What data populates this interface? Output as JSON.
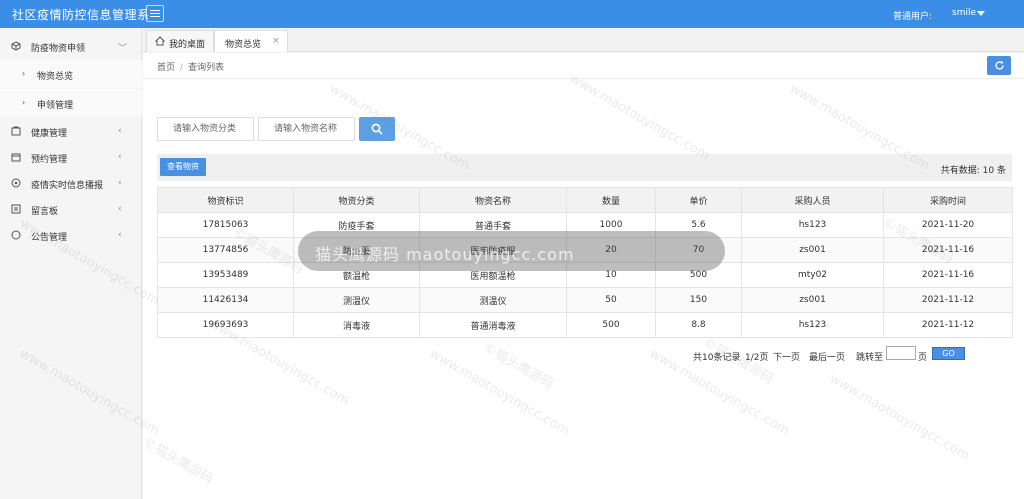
{
  "header": {
    "app_title": "社区疫情防控信息管理系",
    "user_role": "普通用户:",
    "user_name": "smile"
  },
  "sidebar": {
    "items": [
      {
        "label": "防疫物资申领",
        "icon": "cube-icon",
        "expanded": true,
        "children": [
          {
            "label": "物资总览"
          },
          {
            "label": "申领管理"
          }
        ]
      },
      {
        "label": "健康管理",
        "icon": "health-icon"
      },
      {
        "label": "预约管理",
        "icon": "calendar-icon"
      },
      {
        "label": "疫情实时信息播报",
        "icon": "broadcast-icon"
      },
      {
        "label": "留言板",
        "icon": "message-icon"
      },
      {
        "label": "公告管理",
        "icon": "notice-icon"
      }
    ]
  },
  "tabs": [
    {
      "label": "我的桌面",
      "icon": "home-icon"
    },
    {
      "label": "物资总览",
      "active": true,
      "close": "×"
    }
  ],
  "breadcrumb": {
    "home": "首页",
    "sep": "/",
    "current": "查询列表"
  },
  "search": {
    "category_placeholder": "请输入物资分类",
    "name_placeholder": "请输入物资名称"
  },
  "toolbar": {
    "view_label": "查看物资",
    "total_label": "共有数据: 10 条"
  },
  "table": {
    "columns": [
      "物资标识",
      "物资分类",
      "物资名称",
      "数量",
      "单价",
      "采购人员",
      "采购时间"
    ],
    "rows": [
      [
        "17815063",
        "防疫手套",
        "普通手套",
        "1000",
        "5.6",
        "hs123",
        "2021-11-20"
      ],
      [
        "13774856",
        "防疫服",
        "医用防疫服",
        "20",
        "70",
        "zs001",
        "2021-11-16"
      ],
      [
        "13953489",
        "额温枪",
        "医用额温枪",
        "10",
        "500",
        "mty02",
        "2021-11-16"
      ],
      [
        "11426134",
        "测温仪",
        "测温仪",
        "50",
        "150",
        "zs001",
        "2021-11-12"
      ],
      [
        "19693693",
        "消毒液",
        "普通消毒液",
        "500",
        "8.8",
        "hs123",
        "2021-11-12"
      ]
    ]
  },
  "pager": {
    "records": "共10条记录",
    "page": "1/2页",
    "next": "下一页",
    "last": "最后一页",
    "jump": "跳转至",
    "page_unit": "页",
    "go": "GO"
  },
  "watermark": {
    "text": "©猫头鹰源码",
    "url": "www.maotouyingcc.com",
    "center": "猫头鹰源码 maotouyingcc.com"
  },
  "colors": {
    "header": "#3a8ee6",
    "accent": "#4a90e2"
  }
}
